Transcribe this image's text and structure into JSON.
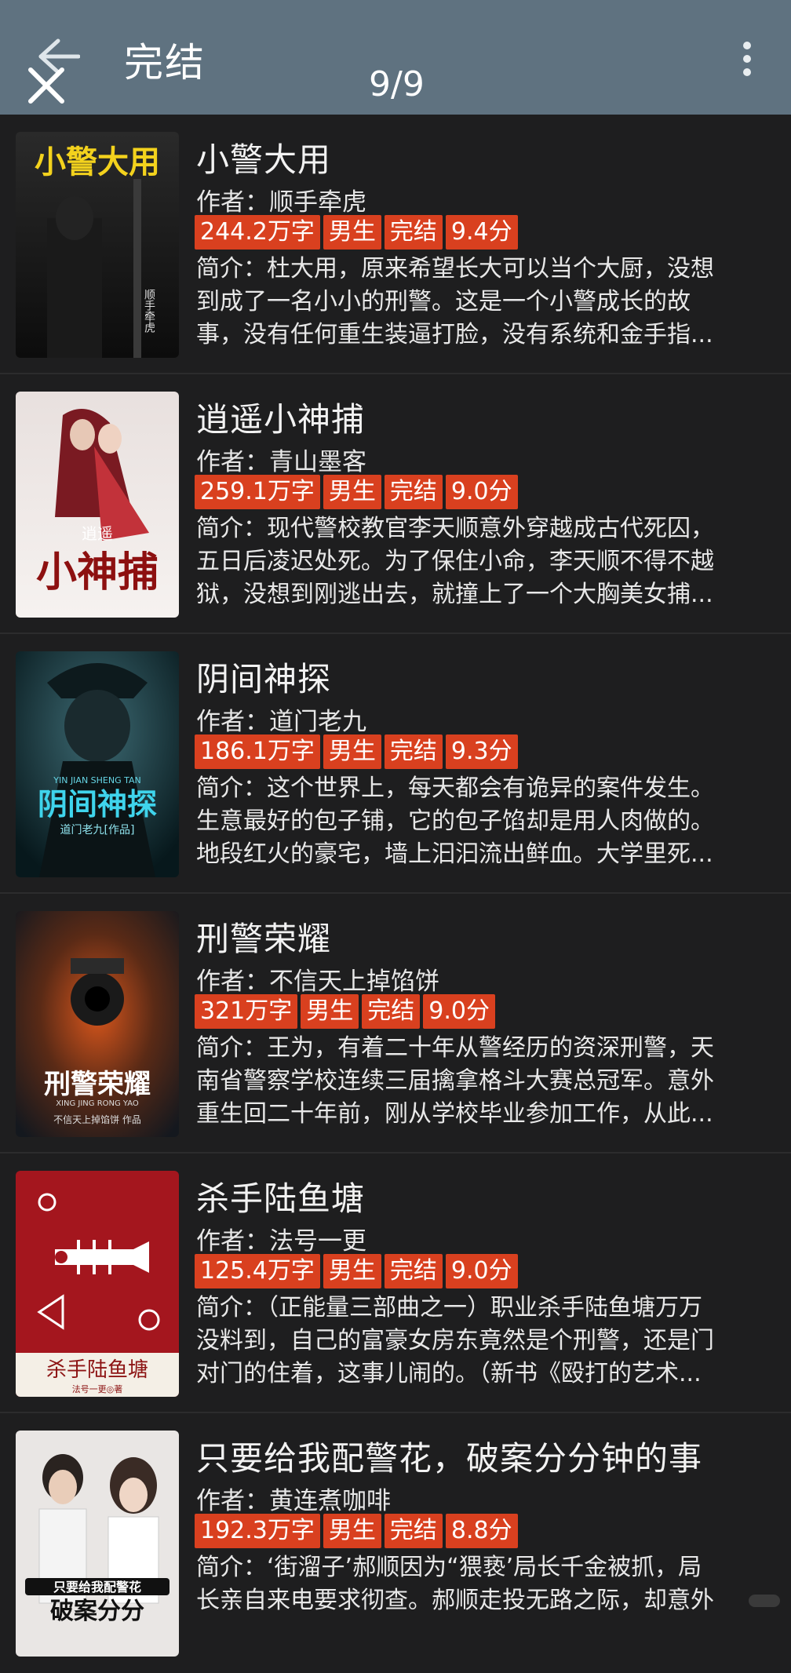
{
  "header": {
    "title": "完结",
    "pager": "9/9",
    "back_icon": "arrow-left-icon",
    "close_icon": "close-icon",
    "more_icon": "more-vertical-icon"
  },
  "colors": {
    "header_bg": "#5f7280",
    "tag_bg": "#d9401f",
    "page_bg": "#1e1e1f"
  },
  "books": [
    {
      "title": "小警大用",
      "author_label": "作者：",
      "author": "顺手牵虎",
      "tags": [
        "244.2万字",
        "男生",
        "完结",
        "9.4分"
      ],
      "intro_label": "简介：",
      "intro_lines": [
        "杜大用，原来希望长大可以当个大厨，没想",
        "到成了一名小小的刑警。这是一个小警成长的故",
        "事，没有任何重生装逼打脸，没有系统和金手指..."
      ],
      "cover_text": "小警大用",
      "cover_sub": "顺手牵虎"
    },
    {
      "title": "逍遥小神捕",
      "author_label": "作者：",
      "author": "青山墨客",
      "tags": [
        "259.1万字",
        "男生",
        "完结",
        "9.0分"
      ],
      "intro_label": "简介：",
      "intro_lines": [
        "现代警校教官李天顺意外穿越成古代死囚，",
        "五日后凌迟处死。为了保住小命，李天顺不得不越",
        "狱，没想到刚逃出去，就撞上了一个大胸美女捕..."
      ],
      "cover_text": "逍遥小神捕",
      "cover_sub": "青山墨客"
    },
    {
      "title": "阴间神探",
      "author_label": "作者：",
      "author": "道门老九",
      "tags": [
        "186.1万字",
        "男生",
        "完结",
        "9.3分"
      ],
      "intro_label": "简介：",
      "intro_lines": [
        "这个世界上，每天都会有诡异的案件发生。",
        "生意最好的包子铺，它的包子馅却是用人肉做的。",
        "地段红火的豪宅，墙上汩汩流出鲜血。大学里死..."
      ],
      "cover_text": "阴间神探",
      "cover_sub": "道门老九[作品]",
      "cover_pinyin": "YIN JIAN SHENG TAN"
    },
    {
      "title": "刑警荣耀",
      "author_label": "作者：",
      "author": "不信天上掉馅饼",
      "tags": [
        "321万字",
        "男生",
        "完结",
        "9.0分"
      ],
      "intro_label": "简介：",
      "intro_lines": [
        "王为，有着二十年从警经历的资深刑警，天",
        "南省警察学校连续三届擒拿格斗大赛总冠军。意外",
        "重生回二十年前，刚从学校毕业参加工作，从此..."
      ],
      "cover_text": "刑警荣耀",
      "cover_pinyin": "XING JING RONG YAO",
      "cover_sub": "不信天上掉馅饼 作品"
    },
    {
      "title": "杀手陆鱼塘",
      "author_label": "作者：",
      "author": "法号一更",
      "tags": [
        "125.4万字",
        "男生",
        "完结",
        "9.0分"
      ],
      "intro_label": "简介：",
      "intro_lines": [
        "（正能量三部曲之一）职业杀手陆鱼塘万万",
        "没料到，自己的富豪女房东竟然是个刑警，还是门",
        "对门的住着，这事儿闹的。（新书《殴打的艺术..."
      ],
      "cover_text": "杀手陆鱼塘",
      "cover_sub": "法号一更◎著"
    },
    {
      "title": "只要给我配警花，破案分分钟的事",
      "author_label": "作者：",
      "author": "黄连煮咖啡",
      "tags": [
        "192.3万字",
        "男生",
        "完结",
        "8.8分"
      ],
      "intro_label": "简介：",
      "intro_lines": [
        "‘街溜子’郝顺因为“猥亵’局长千金被抓，局",
        "长亲自来电要求彻查。郝顺走投无路之际，却意外"
      ],
      "cover_text": "只要给我配警花",
      "cover_text2": "破案分分"
    }
  ]
}
